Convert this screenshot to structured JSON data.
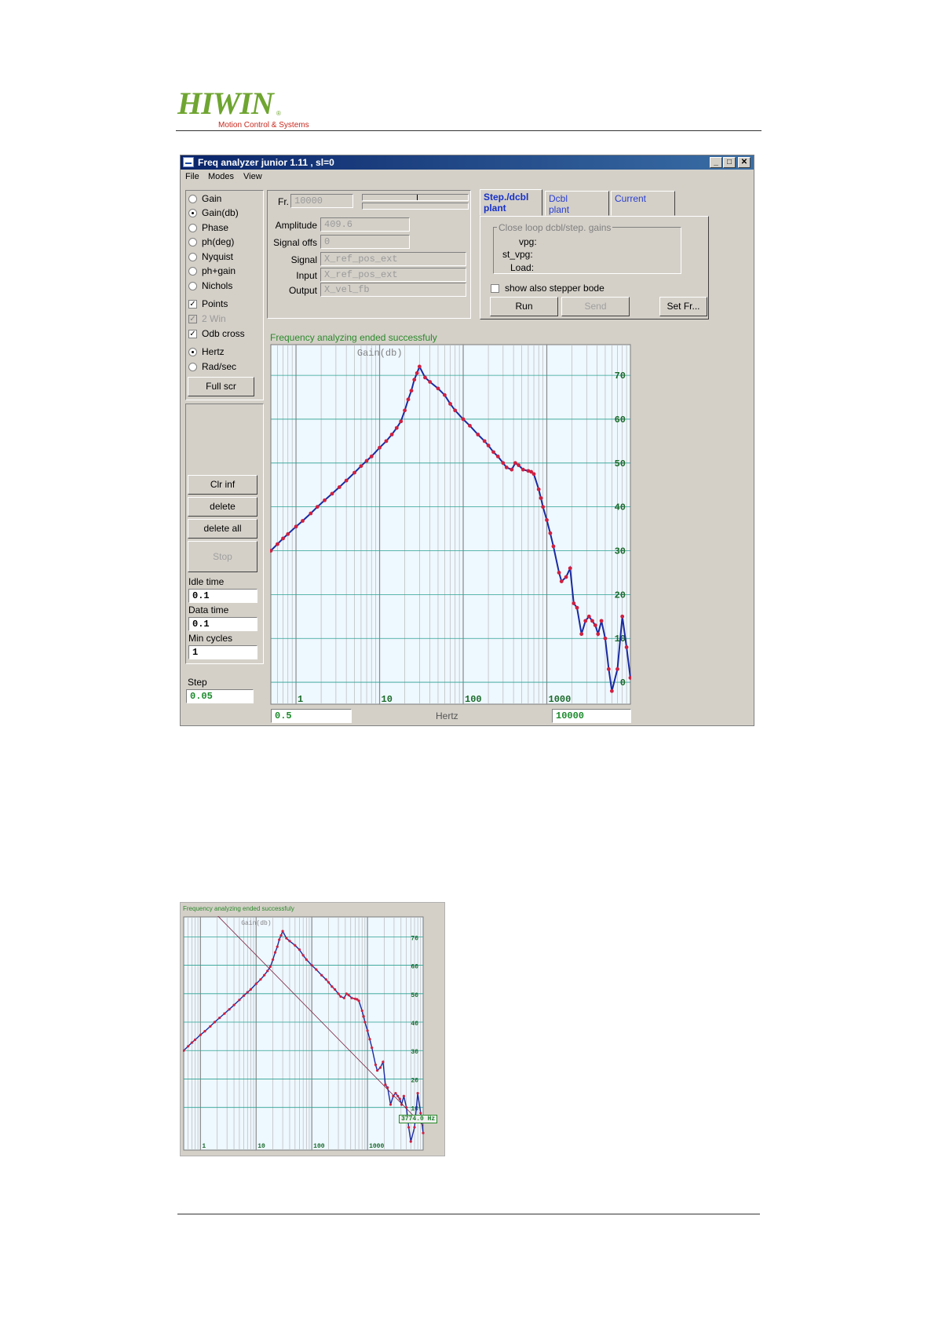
{
  "header": {
    "logo_text": "HIWIN",
    "logo_mark": "®",
    "logo_subtitle": "Motion Control & Systems"
  },
  "window": {
    "title": "Freq analyzer junior 1.11 , sl=0",
    "menu": [
      "File",
      "Modes",
      "View"
    ]
  },
  "left_panel": {
    "display_modes": [
      {
        "label": "Gain",
        "selected": false
      },
      {
        "label": "Gain(db)",
        "selected": true
      },
      {
        "label": "Phase",
        "selected": false
      },
      {
        "label": "ph(deg)",
        "selected": false
      },
      {
        "label": "Nyquist",
        "selected": false
      },
      {
        "label": "ph+gain",
        "selected": false
      },
      {
        "label": "Nichols",
        "selected": false
      }
    ],
    "checkboxes": [
      {
        "label": "Points",
        "checked": true,
        "enabled": true
      },
      {
        "label": "2 Win",
        "checked": true,
        "enabled": false
      },
      {
        "label": "Odb cross",
        "checked": true,
        "enabled": true
      }
    ],
    "units": [
      {
        "label": "Hertz",
        "selected": true
      },
      {
        "label": "Rad/sec",
        "selected": false
      }
    ],
    "full_scr": "Full scr",
    "clr_inf": "Clr inf",
    "delete": "delete",
    "delete_all": "delete all",
    "stop": "Stop",
    "idle_time_label": "Idle time",
    "idle_time": "0.1",
    "data_time_label": "Data time",
    "data_time": "0.1",
    "min_cycles_label": "Min cycles",
    "min_cycles": "1",
    "step_label": "Step",
    "step": "0.05"
  },
  "signal_panel": {
    "fr_label": "Fr.",
    "fr_value": "10000",
    "amplitude_label": "Amplitude",
    "amplitude": "409.6",
    "signal_offs_label": "Signal offs",
    "signal_offs": "0",
    "signal_label": "Signal",
    "signal": "X_ref_pos_ext",
    "input_label": "Input",
    "input": "X_ref_pos_ext",
    "output_label": "Output",
    "output": "X_vel_fb"
  },
  "tabs": [
    {
      "label_1": "Step./dcbl",
      "label_2": "plant",
      "active": true
    },
    {
      "label_1": "Dcbl",
      "label_2": "plant",
      "active": false
    },
    {
      "label_1": "Current",
      "label_2": "",
      "active": false
    }
  ],
  "gains": {
    "group_title": "Close loop dcbl/step. gains",
    "vpg_label": "vpg:",
    "st_vpg_label": "st_vpg:",
    "load_label": "Load:",
    "stepper_bode_label": "show also stepper bode",
    "stepper_bode_checked": false,
    "run": "Run",
    "send": "Send",
    "set_fr": "Set Fr..."
  },
  "status_text": "Frequency analyzing ended successfuly",
  "plot": {
    "xmin_value": "0.5",
    "xmax_value": "10000",
    "x_unit": "Hertz"
  },
  "chart_data": [
    {
      "type": "line",
      "title": "Gain(db)",
      "xscale": "log",
      "xlim": [
        0.5,
        10000
      ],
      "ylim": [
        -5,
        77
      ],
      "xticks": [
        1,
        10,
        100,
        1000
      ],
      "xtick_labels": [
        "1",
        "10",
        "100",
        "1000"
      ],
      "yticks": [
        0,
        10,
        20,
        30,
        40,
        50,
        60,
        70
      ],
      "ytick_labels": [
        "0",
        "10",
        "20",
        "30",
        "40",
        "50",
        "60",
        "70"
      ],
      "grid": true,
      "markers": true,
      "series": [
        {
          "color": "#1a2aa0",
          "marker_color": "#d02040",
          "x": [
            0.5,
            0.6,
            0.7,
            0.8,
            1,
            1.2,
            1.5,
            1.8,
            2.2,
            2.7,
            3.3,
            4,
            5,
            6,
            7,
            8,
            10,
            12,
            14,
            16,
            18,
            20,
            22,
            24,
            26,
            28,
            30,
            35,
            40,
            50,
            60,
            70,
            80,
            100,
            120,
            150,
            180,
            200,
            230,
            260,
            300,
            330,
            380,
            420,
            460,
            520,
            600,
            650,
            700,
            800,
            850,
            900,
            1000,
            1100,
            1200,
            1400,
            1500,
            1700,
            1900,
            2100,
            2300,
            2600,
            2900,
            3200,
            3500,
            3800,
            4100,
            4500,
            5000,
            5500,
            6000,
            7000,
            8000,
            9000,
            10000
          ],
          "y": [
            30,
            31.5,
            32.8,
            33.8,
            35.5,
            36.8,
            38.5,
            40,
            41.5,
            43,
            44.5,
            46,
            47.8,
            49.3,
            50.5,
            51.5,
            53.5,
            55,
            56.5,
            58,
            59.5,
            62,
            64.5,
            66.5,
            69,
            70.5,
            72,
            69.5,
            68.5,
            67,
            65.5,
            63.5,
            62,
            60,
            58.5,
            56.5,
            55,
            54,
            52.5,
            51.5,
            50,
            49,
            48.5,
            50,
            49.5,
            48.5,
            48.2,
            48,
            47.5,
            44,
            42,
            40,
            37,
            34,
            31,
            25,
            23,
            24,
            26,
            18,
            17,
            11,
            14,
            15,
            14,
            13,
            11,
            14,
            10,
            3,
            -2,
            3,
            15,
            8,
            1
          ]
        }
      ]
    },
    {
      "type": "line",
      "title": "Gain(db)",
      "xscale": "log",
      "xlim": [
        0.5,
        10000
      ],
      "ylim": [
        -5,
        77
      ],
      "xticks": [
        1,
        10,
        100,
        1000
      ],
      "xtick_labels": [
        "1",
        "10",
        "100",
        "1000"
      ],
      "yticks": [
        10,
        20,
        30,
        40,
        50,
        60,
        70
      ],
      "ytick_labels": [
        "10",
        "20",
        "30",
        "40",
        "50",
        "60",
        "70"
      ],
      "grid": true,
      "annotations": [
        "Frequency analyzing ended successfuly",
        "3774.0 Hz"
      ],
      "cursor_frequency_hz": 3774.0,
      "series": [
        {
          "color": "#1a2aa0",
          "marker_color": "#d02040",
          "x": [
            0.5,
            0.6,
            0.7,
            0.8,
            1,
            1.2,
            1.5,
            1.8,
            2.2,
            2.7,
            3.3,
            4,
            5,
            6,
            7,
            8,
            10,
            12,
            14,
            16,
            18,
            20,
            22,
            24,
            26,
            28,
            30,
            35,
            40,
            50,
            60,
            70,
            80,
            100,
            120,
            150,
            180,
            200,
            230,
            260,
            300,
            330,
            380,
            420,
            460,
            520,
            600,
            650,
            700,
            800,
            850,
            900,
            1000,
            1100,
            1200,
            1400,
            1500,
            1700,
            1900,
            2100,
            2300,
            2600,
            2900,
            3200,
            3500,
            3800,
            4100,
            4500,
            5000,
            5500,
            6000,
            7000,
            8000,
            9000,
            10000
          ],
          "y": [
            30,
            31.5,
            32.8,
            33.8,
            35.5,
            36.8,
            38.5,
            40,
            41.5,
            43,
            44.5,
            46,
            47.8,
            49.3,
            50.5,
            51.5,
            53.5,
            55,
            56.5,
            58,
            59.5,
            62,
            64.5,
            66.5,
            69,
            70.5,
            72,
            69.5,
            68.5,
            67,
            65.5,
            63.5,
            62,
            60,
            58.5,
            56.5,
            55,
            54,
            52.5,
            51.5,
            50,
            49,
            48.5,
            50,
            49.5,
            48.5,
            48.2,
            48,
            47.5,
            44,
            42,
            40,
            37,
            34,
            31,
            25,
            23,
            24,
            26,
            18,
            17,
            11,
            14,
            15,
            14,
            13,
            11,
            14,
            10,
            3,
            -2,
            3,
            15,
            8,
            1
          ]
        },
        {
          "color": "#7a2040",
          "x": [
            0.5,
            10000
          ],
          "y": [
            89.6,
            3.6
          ]
        }
      ]
    }
  ]
}
